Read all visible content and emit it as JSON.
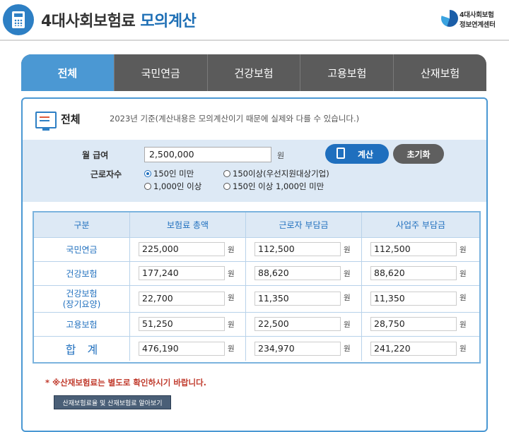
{
  "header": {
    "title_main": "4대사회보험료",
    "title_sub": "모의계산",
    "org_line1": "4대사회보험",
    "org_line2": "정보연계센터"
  },
  "tabs": [
    {
      "label": "전체",
      "active": true
    },
    {
      "label": "국민연금",
      "active": false
    },
    {
      "label": "건강보험",
      "active": false
    },
    {
      "label": "고용보험",
      "active": false
    },
    {
      "label": "산재보험",
      "active": false
    }
  ],
  "section": {
    "title": "전체",
    "notice": "2023년 기준(계산내용은 모의계산이기 때문에 실제와 다를 수 있습니다.)"
  },
  "form": {
    "salary_label": "월 급여",
    "salary_value": "2,500,000",
    "salary_unit": "원",
    "calc_button": "계산",
    "reset_button": "초기화",
    "worker_label": "근로자수",
    "options": [
      {
        "label": "150인 미만",
        "checked": true
      },
      {
        "label": "150이상(우선지원대상기업)",
        "checked": false
      },
      {
        "label": "1,000인 이상",
        "checked": false
      },
      {
        "label": "150인 이상 1,000인 미만",
        "checked": false
      }
    ]
  },
  "table": {
    "headers": [
      "구분",
      "보험료 총액",
      "근로자 부담금",
      "사업주 부담금"
    ],
    "unit": "원",
    "rows": [
      {
        "label": "국민연금",
        "values": [
          "225,000",
          "112,500",
          "112,500"
        ]
      },
      {
        "label": "건강보험",
        "values": [
          "177,240",
          "88,620",
          "88,620"
        ]
      },
      {
        "label": "건강보험\n(장기요양)",
        "values": [
          "22,700",
          "11,350",
          "11,350"
        ]
      },
      {
        "label": "고용보험",
        "values": [
          "51,250",
          "22,500",
          "28,750"
        ]
      },
      {
        "label": "합계",
        "values": [
          "476,190",
          "234,970",
          "241,220"
        ]
      }
    ]
  },
  "footer": {
    "warning": "* ※산재보험료는 별도로 확인하시기 바랍니다.",
    "info_button": "산재보험료율 및 산재보험료 알아보기"
  },
  "colors": {
    "accent": "#4b98d3",
    "primary_button": "#1f6fbe",
    "warning": "#c0392b"
  }
}
